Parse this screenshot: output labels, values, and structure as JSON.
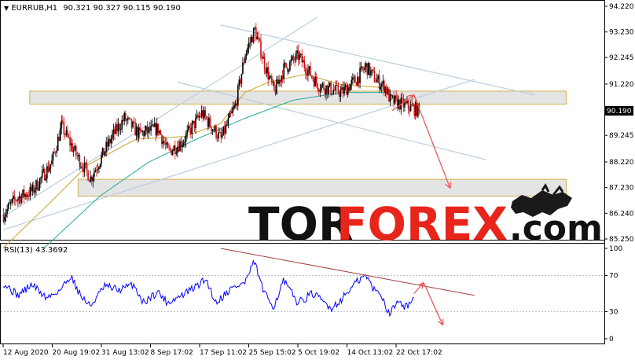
{
  "header": {
    "symbol": "EURRUB,H1",
    "ohlc": "90.321 90.327 90.115 90.190",
    "rsi_label": "RSI(13) 43.3692"
  },
  "logo": {
    "part1": "TOR",
    "part2": "FOREX",
    "part3": ".com"
  },
  "colors": {
    "up_candle": "#000000",
    "down_candle": "#d01010",
    "ma_fast": "#c9a227",
    "ma_slow": "#22aaa0",
    "channel": "#b9cde0",
    "zone_fill": "#e4e4e4",
    "zone_border": "#d6b050",
    "arrow": "#e85a5a",
    "rsi_line": "#0000ff",
    "rsi_trend": "#a04040",
    "logo_dark": "#111111",
    "logo_red": "#e8251b"
  },
  "chart_data": [
    {
      "type": "candlestick",
      "title": "EURRUB,H1",
      "ylim": [
        85.25,
        94.22
      ],
      "y_ticks": [
        "94.220",
        "93.230",
        "92.245",
        "91.220",
        "90.190",
        "89.245",
        "88.220",
        "87.230",
        "86.240",
        "85.250"
      ],
      "last_price": "90.190",
      "x_ticks": [
        "12 Aug 2020",
        "20 Aug 19:02",
        "31 Aug 13:02",
        "8 Sep 17:02",
        "17 Sep 11:02",
        "25 Sep 15:02",
        "5 Oct 19:02",
        "14 Oct 13:02",
        "22 Oct 17:02"
      ],
      "price_path": [
        [
          0,
          86.2
        ],
        [
          5,
          86.8
        ],
        [
          12,
          87.1
        ],
        [
          20,
          88.2
        ],
        [
          24,
          89.6
        ],
        [
          30,
          88.5
        ],
        [
          36,
          87.6
        ],
        [
          45,
          89.2
        ],
        [
          50,
          89.9
        ],
        [
          56,
          89.3
        ],
        [
          64,
          89.5
        ],
        [
          68,
          88.6
        ],
        [
          74,
          89.0
        ],
        [
          82,
          90.1
        ],
        [
          90,
          89.1
        ],
        [
          96,
          90.4
        ],
        [
          100,
          92.4
        ],
        [
          104,
          93.3
        ],
        [
          108,
          92.0
        ],
        [
          112,
          90.9
        ],
        [
          116,
          91.8
        ],
        [
          122,
          92.3
        ],
        [
          130,
          91.2
        ],
        [
          136,
          91.0
        ],
        [
          140,
          90.9
        ],
        [
          146,
          91.4
        ],
        [
          150,
          91.9
        ],
        [
          154,
          91.4
        ],
        [
          158,
          91.1
        ],
        [
          160,
          90.6
        ],
        [
          166,
          90.4
        ],
        [
          172,
          90.2
        ]
      ],
      "series": [
        {
          "name": "",
          "kind": "ma_fast",
          "values": [
            [
              0,
              84.9
            ],
            [
              20,
              86.7
            ],
            [
              35,
              88.1
            ],
            [
              55,
              89.1
            ],
            [
              75,
              89.2
            ],
            [
              90,
              89.7
            ],
            [
              100,
              90.9
            ],
            [
              110,
              91.3
            ],
            [
              125,
              91.6
            ],
            [
              140,
              91.2
            ],
            [
              155,
              91.1
            ],
            [
              160,
              90.8
            ]
          ]
        },
        {
          "name": "",
          "kind": "ma_slow",
          "values": [
            [
              17,
              84.9
            ],
            [
              40,
              86.9
            ],
            [
              60,
              88.2
            ],
            [
              80,
              89.1
            ],
            [
              100,
              89.9
            ],
            [
              120,
              90.6
            ],
            [
              140,
              90.9
            ],
            [
              160,
              90.9
            ]
          ]
        }
      ],
      "channels": [
        {
          "from": [
            0,
            86.1
          ],
          "to": [
            130,
            93.8
          ]
        },
        {
          "from": [
            0,
            85.6
          ],
          "to": [
            195,
            91.4
          ]
        },
        {
          "from": [
            90,
            93.5
          ],
          "to": [
            220,
            90.8
          ]
        },
        {
          "from": [
            72,
            91.3
          ],
          "to": [
            200,
            88.3
          ]
        }
      ],
      "zones": [
        {
          "low": 90.45,
          "high": 90.95,
          "from": 11,
          "to": 233
        },
        {
          "low": 86.9,
          "high": 87.55,
          "from": 31,
          "to": 233
        }
      ],
      "forecast": [
        [
          161,
          90.2
        ],
        [
          170,
          90.8
        ],
        [
          185,
          87.2
        ]
      ]
    },
    {
      "type": "line",
      "title": "RSI(13) 43.3692",
      "ylim": [
        0,
        100
      ],
      "y_ticks": [
        "100",
        "70",
        "30",
        "0"
      ],
      "value": 43.3692,
      "rsi_path": [
        [
          0,
          62
        ],
        [
          6,
          48
        ],
        [
          12,
          60
        ],
        [
          18,
          45
        ],
        [
          24,
          55
        ],
        [
          28,
          70
        ],
        [
          32,
          48
        ],
        [
          36,
          36
        ],
        [
          42,
          58
        ],
        [
          48,
          54
        ],
        [
          54,
          60
        ],
        [
          58,
          40
        ],
        [
          64,
          52
        ],
        [
          68,
          40
        ],
        [
          74,
          48
        ],
        [
          80,
          58
        ],
        [
          84,
          66
        ],
        [
          88,
          40
        ],
        [
          94,
          55
        ],
        [
          100,
          62
        ],
        [
          104,
          85
        ],
        [
          108,
          50
        ],
        [
          112,
          36
        ],
        [
          116,
          64
        ],
        [
          122,
          40
        ],
        [
          128,
          50
        ],
        [
          132,
          42
        ],
        [
          136,
          34
        ],
        [
          140,
          44
        ],
        [
          146,
          62
        ],
        [
          150,
          70
        ],
        [
          154,
          52
        ],
        [
          156,
          52
        ],
        [
          158,
          38
        ],
        [
          160,
          28
        ],
        [
          164,
          45
        ],
        [
          166,
          35
        ],
        [
          170,
          43
        ]
      ],
      "trendline": {
        "from": [
          90,
          100
        ],
        "to": [
          195,
          48
        ]
      },
      "forecast": [
        [
          170,
          50
        ],
        [
          174,
          62
        ],
        [
          182,
          15
        ]
      ]
    }
  ]
}
